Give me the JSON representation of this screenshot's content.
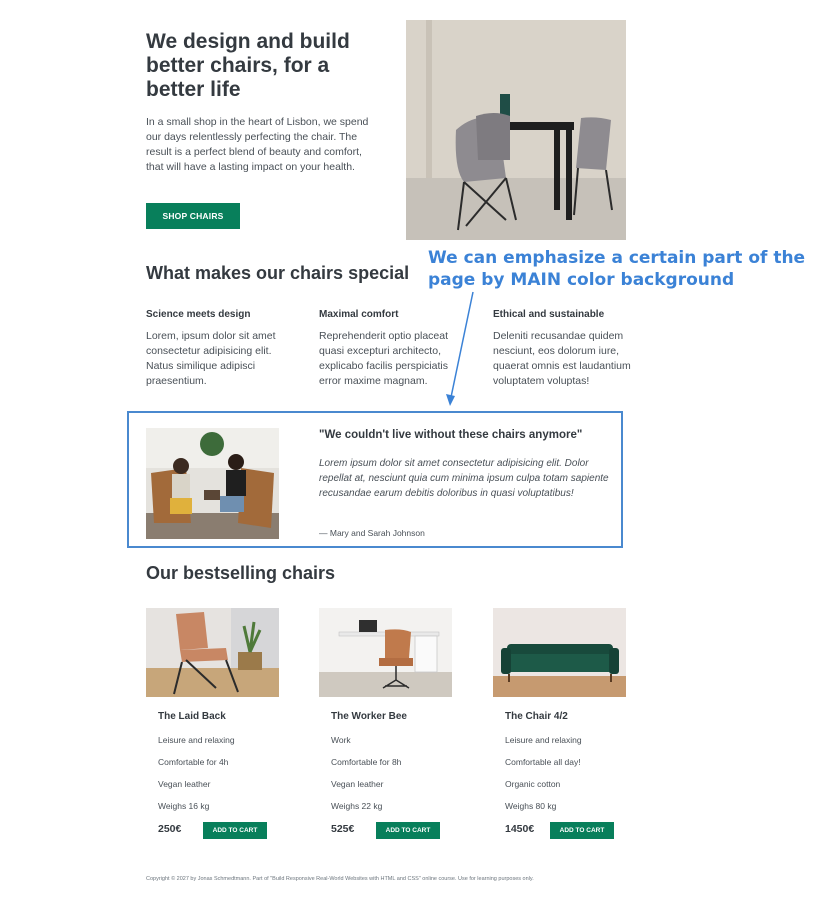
{
  "hero": {
    "title": "We design and build better chairs, for a better life",
    "text": "In a small shop in the heart of Lisbon, we spend our days relentlessly perfecting the chair. The result is a perfect blend of beauty and comfort, that will have a lasting impact on your health.",
    "button_label": "SHOP CHAIRS"
  },
  "features": {
    "title": "What makes our chairs special",
    "items": [
      {
        "title": "Science meets design",
        "text": "Lorem, ipsum dolor sit amet consectetur adipisicing elit. Natus similique adipisci praesentium."
      },
      {
        "title": "Maximal comfort",
        "text": "Reprehenderit optio placeat quasi excepturi architecto, explicabo facilis perspiciatis error maxime magnam."
      },
      {
        "title": "Ethical and sustainable",
        "text": "Deleniti recusandae quidem nesciunt, eos dolorum iure, quaerat omnis est laudantium voluptatem voluptas!"
      }
    ]
  },
  "annotation": {
    "text": "We can emphasize a certain part of the page by MAIN color background",
    "color": "#3b82d6"
  },
  "testimonial": {
    "quote": "\"We couldn't live without these chairs anymore\"",
    "text": "Lorem ipsum dolor sit amet consectetur adipisicing elit. Dolor repellat at, nesciunt quia cum minima ipsum culpa totam sapiente recusandae earum debitis doloribus in quasi voluptatibus!",
    "author": "— Mary and Sarah Johnson"
  },
  "bestsellers": {
    "title": "Our bestselling chairs",
    "products": [
      {
        "name": "The Laid Back",
        "attrs": [
          "Leisure and relaxing",
          "Comfortable for 4h",
          "Vegan leather",
          "Weighs 16 kg"
        ],
        "price": "250€",
        "cart_label": "ADD TO CART"
      },
      {
        "name": "The Worker Bee",
        "attrs": [
          "Work",
          "Comfortable for 8h",
          "Vegan leather",
          "Weighs 22 kg"
        ],
        "price": "525€",
        "cart_label": "ADD TO CART"
      },
      {
        "name": "The Chair 4/2",
        "attrs": [
          "Leisure and relaxing",
          "Comfortable all day!",
          "Organic cotton",
          "Weighs 80 kg"
        ],
        "price": "1450€",
        "cart_label": "ADD TO CART"
      }
    ]
  },
  "footer": {
    "text": "Copyright © 2027 by Jonas Schmedtmann. Part of \"Build Responsive Real-World Websites with HTML and CSS\" online course. Use for learning purposes only."
  },
  "colors": {
    "primary": "#087f5b",
    "text": "#343a40",
    "annotation": "#3b82d6"
  }
}
